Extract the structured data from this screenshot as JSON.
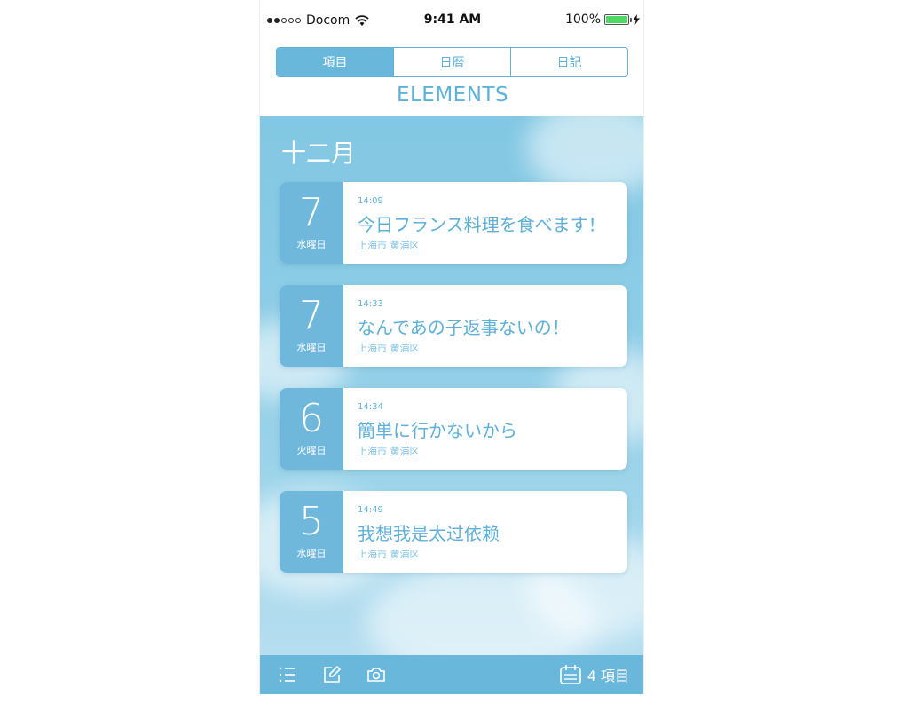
{
  "status_bar": {
    "carrier": "Docom",
    "time": "9:41 AM",
    "battery": "100%"
  },
  "segments": [
    {
      "label": "項目",
      "active": true
    },
    {
      "label": "日暦",
      "active": false
    },
    {
      "label": "日記",
      "active": false
    }
  ],
  "page_title": "ELEMENTS",
  "month": "十二月",
  "entries": [
    {
      "day": "7",
      "weekday": "水曜日",
      "time": "14:09",
      "title": "今日フランス料理を食べます！",
      "location": "上海市 黄浦区"
    },
    {
      "day": "7",
      "weekday": "水曜日",
      "time": "14:33",
      "title": "なんであの子返事ないの！",
      "location": "上海市 黄浦区"
    },
    {
      "day": "6",
      "weekday": "火曜日",
      "time": "14:34",
      "title": "簡単に行かないから",
      "location": "上海市 黄浦区"
    },
    {
      "day": "5",
      "weekday": "水曜日",
      "time": "14:49",
      "title": "我想我是太过依赖",
      "location": "上海市 黄浦区"
    }
  ],
  "toolbar": {
    "count_label": "4 項目",
    "icons": [
      "list-icon",
      "compose-icon",
      "camera-icon",
      "calendar-icon"
    ]
  },
  "colors": {
    "accent": "#6ab7dc",
    "text_accent": "#5fb0d7",
    "battery": "#4cd964"
  }
}
